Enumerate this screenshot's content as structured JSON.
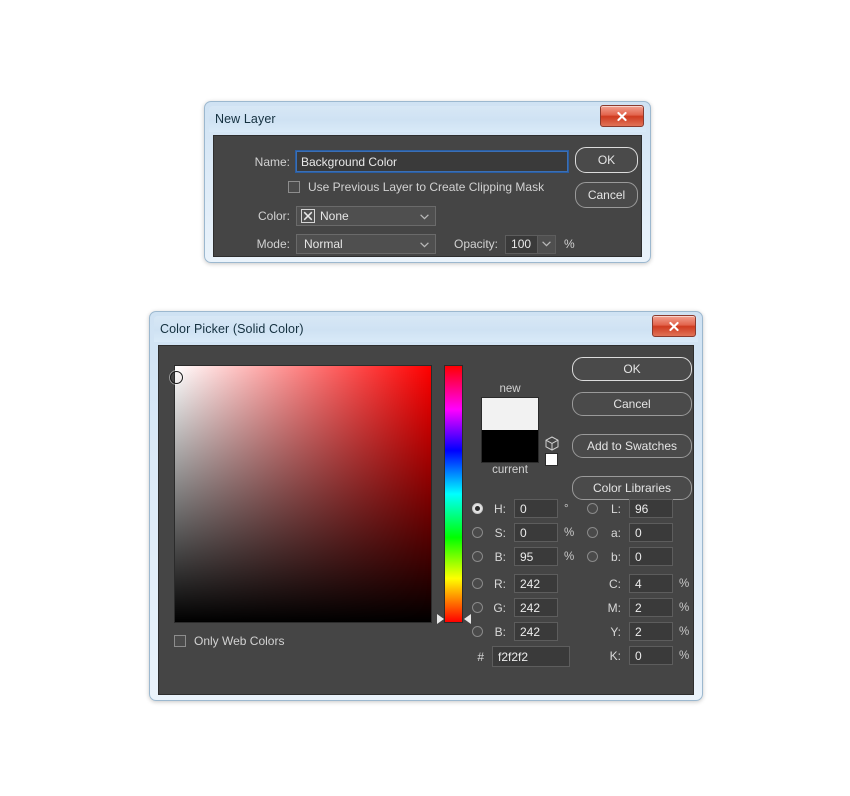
{
  "new_layer_dialog": {
    "title": "New Layer",
    "close_label": "x",
    "name_label": "Name:",
    "name_value": "Background Color",
    "clipping_mask_label": "Use Previous Layer to Create Clipping Mask",
    "clipping_mask_checked": false,
    "color_label": "Color:",
    "color_value": "None",
    "mode_label": "Mode:",
    "mode_value": "Normal",
    "opacity_label": "Opacity:",
    "opacity_value": "100",
    "opacity_unit": "%",
    "ok_label": "OK",
    "cancel_label": "Cancel"
  },
  "color_picker": {
    "title": "Color Picker (Solid Color)",
    "close_label": "x",
    "buttons": {
      "ok": "OK",
      "cancel": "Cancel",
      "add_to_swatches": "Add to Swatches",
      "color_libraries": "Color Libraries"
    },
    "swatch": {
      "new_label": "new",
      "current_label": "current",
      "new_color": "#f2f2f2",
      "current_color": "#000000",
      "websafe_chip_color": "#ffffff"
    },
    "only_web_colors": {
      "label": "Only Web Colors",
      "checked": false
    },
    "hex": {
      "symbol": "#",
      "value": "f2f2f2"
    },
    "hsb": [
      {
        "key": "H",
        "label": "H:",
        "value": "0",
        "unit": "°",
        "selected": true
      },
      {
        "key": "S",
        "label": "S:",
        "value": "0",
        "unit": "%",
        "selected": false
      },
      {
        "key": "B",
        "label": "B:",
        "value": "95",
        "unit": "%",
        "selected": false
      }
    ],
    "rgb": [
      {
        "key": "R",
        "label": "R:",
        "value": "242",
        "unit": "",
        "selected": false
      },
      {
        "key": "G",
        "label": "G:",
        "value": "242",
        "unit": "",
        "selected": false
      },
      {
        "key": "B",
        "label": "B:",
        "value": "242",
        "unit": "",
        "selected": false
      }
    ],
    "lab": [
      {
        "key": "L",
        "label": "L:",
        "value": "96",
        "unit": "",
        "selected": false
      },
      {
        "key": "a",
        "label": "a:",
        "value": "0",
        "unit": "",
        "selected": false
      },
      {
        "key": "b",
        "label": "b:",
        "value": "0",
        "unit": "",
        "selected": false
      }
    ],
    "cmyk": [
      {
        "key": "C",
        "label": "C:",
        "value": "4",
        "unit": "%"
      },
      {
        "key": "M",
        "label": "M:",
        "value": "2",
        "unit": "%"
      },
      {
        "key": "Y",
        "label": "Y:",
        "value": "2",
        "unit": "%"
      },
      {
        "key": "K",
        "label": "K:",
        "value": "0",
        "unit": "%"
      }
    ],
    "field": {
      "hue_color": "#ff0000",
      "cursor_x_pct": 0,
      "cursor_y_pct": 4
    }
  },
  "theme": {
    "panel_bg": "#454545",
    "frame_bg": "#d4e6f5",
    "text": "#d2d2d2",
    "accent_focus": "#3b6fb5",
    "close_red": "#cf3b20"
  }
}
